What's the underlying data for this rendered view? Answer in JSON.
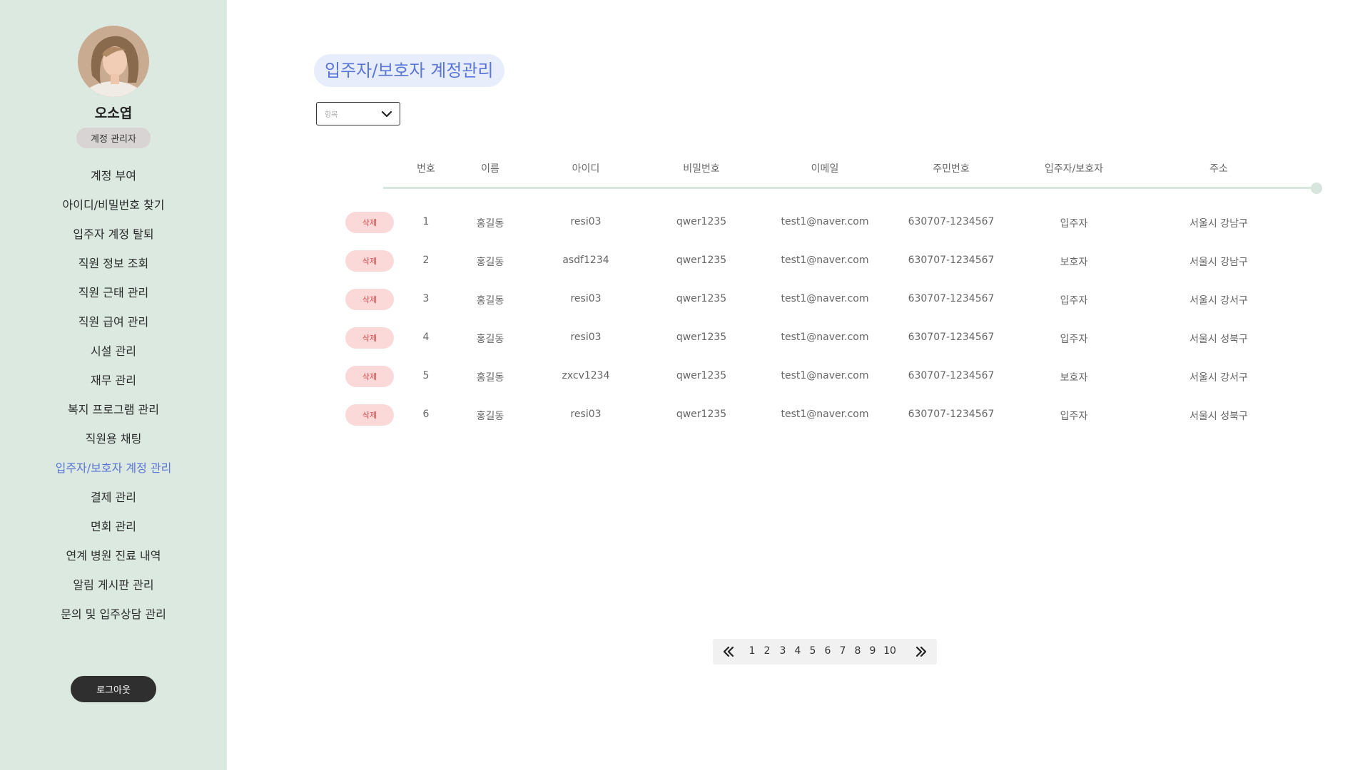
{
  "sidebar": {
    "user_name": "오소엽",
    "role": "계정 관리자",
    "items": [
      {
        "label": "계정 부여"
      },
      {
        "label": "아이디/비밀번호 찾기"
      },
      {
        "label": "입주자 계정 탈퇴"
      },
      {
        "label": "직원 정보 조회"
      },
      {
        "label": "직원 근태 관리"
      },
      {
        "label": "직원 급여 관리"
      },
      {
        "label": "시설 관리"
      },
      {
        "label": "재무 관리"
      },
      {
        "label": "복지 프로그램 관리"
      },
      {
        "label": "직원용 채팅"
      },
      {
        "label": "입주자/보호자 계정 관리",
        "active": true
      },
      {
        "label": "결제 관리"
      },
      {
        "label": "면회 관리"
      },
      {
        "label": "연계 병원 진료 내역"
      },
      {
        "label": "알림 게시판 관리"
      },
      {
        "label": "문의 및 입주상담 관리"
      }
    ],
    "logout_label": "로그아웃"
  },
  "main": {
    "title": "입주자/보호자 계정관리",
    "filter": {
      "placeholder": "항목"
    },
    "table": {
      "columns": [
        "번호",
        "이름",
        "아이디",
        "비밀번호",
        "이메일",
        "주민번호",
        "입주자/보호자",
        "주소"
      ],
      "delete_label": "삭제",
      "rows": [
        {
          "no": "1",
          "name": "홍길동",
          "id": "resi03",
          "password": "qwer1235",
          "email": "test1@naver.com",
          "rrn": "630707-1234567",
          "type": "입주자",
          "address": "서울시 강남구"
        },
        {
          "no": "2",
          "name": "홍길동",
          "id": "asdf1234",
          "password": "qwer1235",
          "email": "test1@naver.com",
          "rrn": "630707-1234567",
          "type": "보호자",
          "address": "서울시 강남구"
        },
        {
          "no": "3",
          "name": "홍길동",
          "id": "resi03",
          "password": "qwer1235",
          "email": "test1@naver.com",
          "rrn": "630707-1234567",
          "type": "입주자",
          "address": "서울시 강서구"
        },
        {
          "no": "4",
          "name": "홍길동",
          "id": "resi03",
          "password": "qwer1235",
          "email": "test1@naver.com",
          "rrn": "630707-1234567",
          "type": "입주자",
          "address": "서울시 성북구"
        },
        {
          "no": "5",
          "name": "홍길동",
          "id": "zxcv1234",
          "password": "qwer1235",
          "email": "test1@naver.com",
          "rrn": "630707-1234567",
          "type": "보호자",
          "address": "서울시 강서구"
        },
        {
          "no": "6",
          "name": "홍길동",
          "id": "resi03",
          "password": "qwer1235",
          "email": "test1@naver.com",
          "rrn": "630707-1234567",
          "type": "입주자",
          "address": "서울시 성북구"
        }
      ]
    },
    "pagination": {
      "pages": [
        "1",
        "2",
        "3",
        "4",
        "5",
        "6",
        "7",
        "8",
        "9",
        "10"
      ]
    }
  },
  "colors": {
    "sidebar_bg": "#dbe9e0",
    "accent": "#5a76d6",
    "title_bg": "#e8edfb",
    "delete_bg": "#fbd9d9",
    "delete_text": "#d84a4a",
    "logout_bg": "#2f2f2f"
  },
  "icons": {
    "select": "chevron-down-icon",
    "prev": "double-chevron-left-icon",
    "next": "double-chevron-right-icon"
  }
}
